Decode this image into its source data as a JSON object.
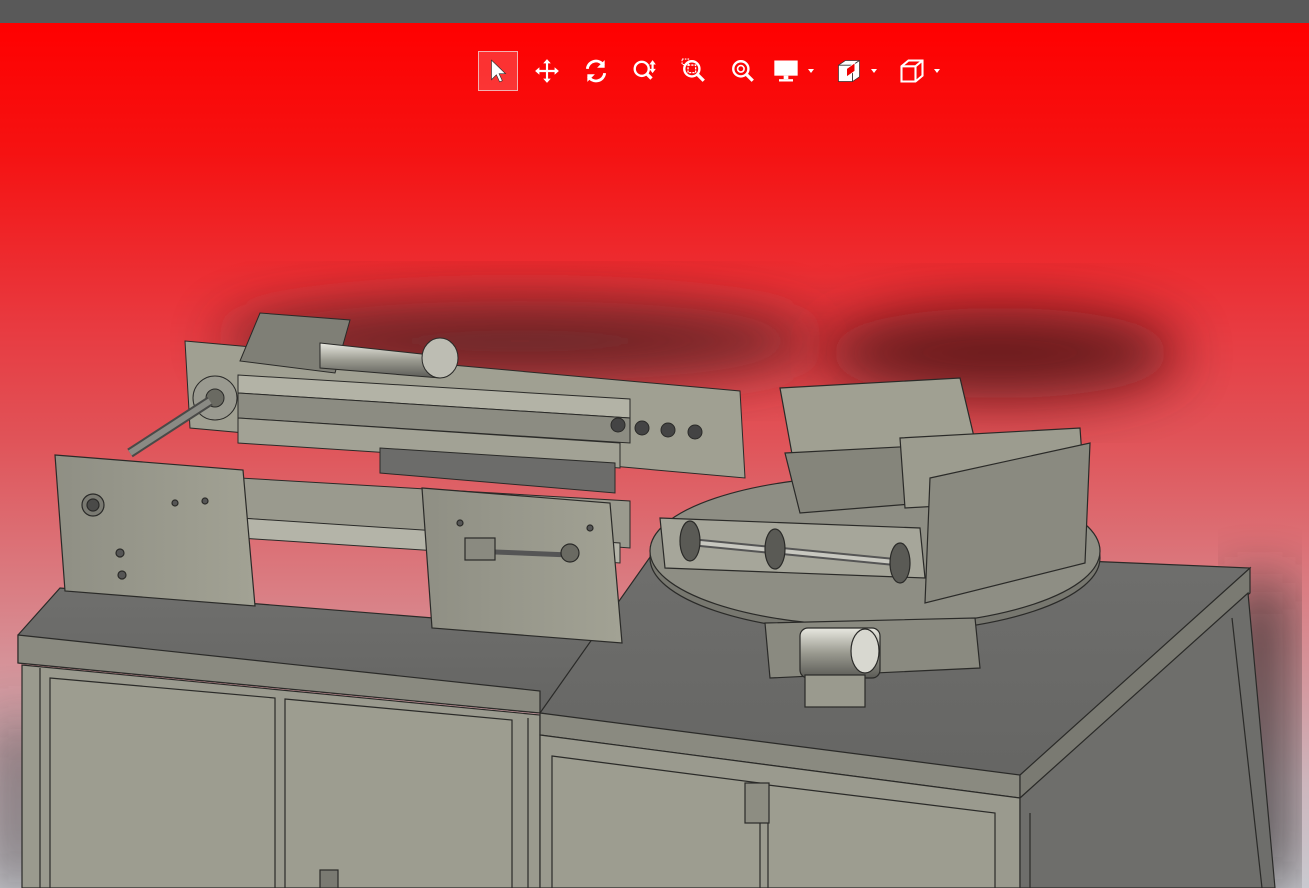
{
  "window": {
    "title": ""
  },
  "toolbar": {
    "tools": [
      {
        "name": "select-tool",
        "icon": "cursor-arrow-icon",
        "active": true
      },
      {
        "name": "pan-tool",
        "icon": "move-arrows-icon",
        "active": false
      },
      {
        "name": "rotate-tool",
        "icon": "rotate-icon",
        "active": false
      },
      {
        "name": "zoom-tool",
        "icon": "zoom-updown-icon",
        "active": false
      },
      {
        "name": "zoom-window-tool",
        "icon": "zoom-window-icon",
        "active": false
      },
      {
        "name": "zoom-fit-tool",
        "icon": "zoom-fit-icon",
        "active": false
      }
    ],
    "dropdowns": [
      {
        "name": "display-mode",
        "icon": "monitor-icon"
      },
      {
        "name": "section-view",
        "icon": "section-icon"
      },
      {
        "name": "view-orientation",
        "icon": "cube-icon"
      }
    ]
  },
  "viewport": {
    "background_top": "#ff0000",
    "background_bottom": "#c9c9cf",
    "model_color": "#9a9a8a",
    "model_dark": "#6a6a66"
  }
}
